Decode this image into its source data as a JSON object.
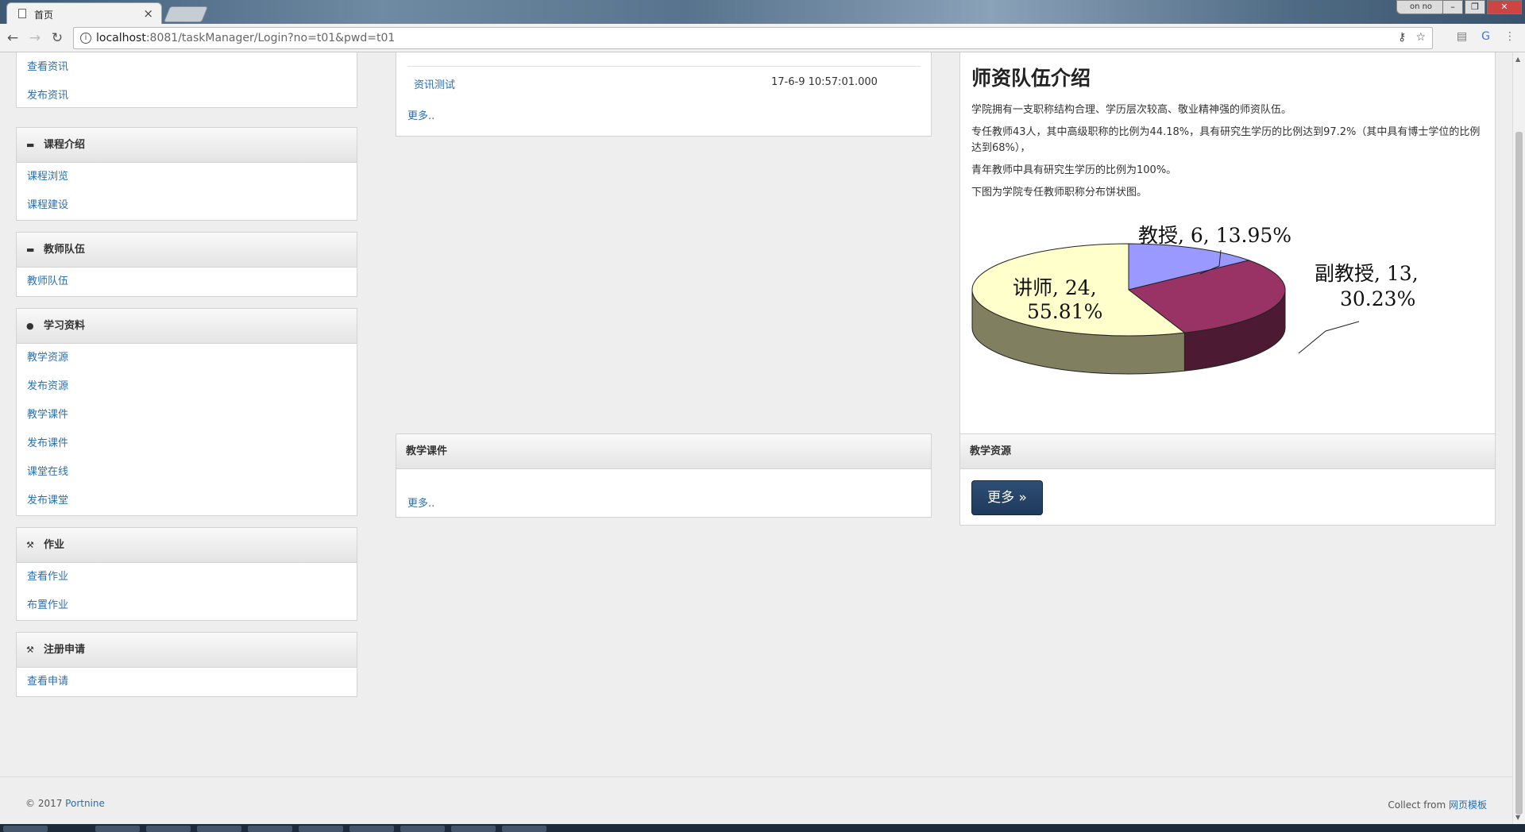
{
  "browser": {
    "tab_title": "首页",
    "tab_close": "×",
    "profile_label": "on no",
    "window_buttons": [
      "–",
      "❐",
      "✕"
    ],
    "url_host": "localhost",
    "url_path": ":8081/taskManager/Login?no=t01&pwd=t01",
    "nav_icons": [
      "back-icon",
      "forward-icon",
      "reload-icon"
    ],
    "nav_glyphs": {
      "back": "←",
      "forward": "→",
      "reload": "↻"
    },
    "omnibox_icons": {
      "key": "⚷",
      "star": "☆"
    },
    "ext_glyphs": {
      "reader": "▤",
      "translate": "G",
      "menu": "⋮"
    }
  },
  "sidebar": {
    "top_links": [
      "查看资讯",
      "发布资讯"
    ],
    "sections": [
      {
        "title": "课程介绍",
        "icon": "briefcase-icon",
        "glyph": "▬",
        "links": [
          "课程浏览",
          "课程建设"
        ]
      },
      {
        "title": "教师队伍",
        "icon": "briefcase-icon",
        "glyph": "▬",
        "links": [
          "教师队伍"
        ]
      },
      {
        "title": "学习资料",
        "icon": "exclamation-icon",
        "glyph": "●",
        "links": [
          "教学资源",
          "发布资源",
          "教学课件",
          "发布课件",
          "课堂在线",
          "发布课堂"
        ]
      },
      {
        "title": "作业",
        "icon": "gavel-icon",
        "glyph": "⚒",
        "links": [
          "查看作业",
          "布置作业"
        ]
      },
      {
        "title": "注册申请",
        "icon": "gavel-icon",
        "glyph": "⚒",
        "links": [
          "查看申请"
        ]
      }
    ]
  },
  "news": {
    "item_title": "资讯测试",
    "item_time": "17-6-9 10:57:01.000",
    "more": "更多.."
  },
  "courseware": {
    "title": "教学课件",
    "more": "更多.."
  },
  "teachers": {
    "heading": "师资队伍介绍",
    "p1": "学院拥有一支职称结构合理、学历层次较高、敬业精神强的师资队伍。",
    "p2": "专任教师43人，其中高级职称的比例为44.18%，具有研究生学历的比例达到97.2%（其中具有博士学位的比例达到68%），",
    "p3": "青年教师中具有研究生学历的比例为100%。",
    "p4": "下图为学院专任教师职称分布饼状图。"
  },
  "chart_data": {
    "type": "pie",
    "style": "3d",
    "slices": [
      {
        "label": "教授",
        "value": 6,
        "percent": "13.95%",
        "color": "#9999ff",
        "side_color": "#6b6bb3",
        "text": "教授, 6, 13.95%"
      },
      {
        "label": "副教授",
        "value": 13,
        "percent": "30.23%",
        "color": "#993366",
        "side_color": "#4d1a33",
        "text1": "副教授, 13,",
        "text2": "30.23%"
      },
      {
        "label": "讲师",
        "value": 24,
        "percent": "55.81%",
        "color": "#ffffcc",
        "side_color": "#808060",
        "text1": "讲师, 24,",
        "text2": "55.81%"
      }
    ]
  },
  "resource": {
    "title": "教学资源",
    "button": "更多 »"
  },
  "footer": {
    "copyright_prefix": "© 2017 ",
    "copyright_link": "Portnine",
    "collect_prefix": "Collect from ",
    "collect_link": "网页模板"
  }
}
